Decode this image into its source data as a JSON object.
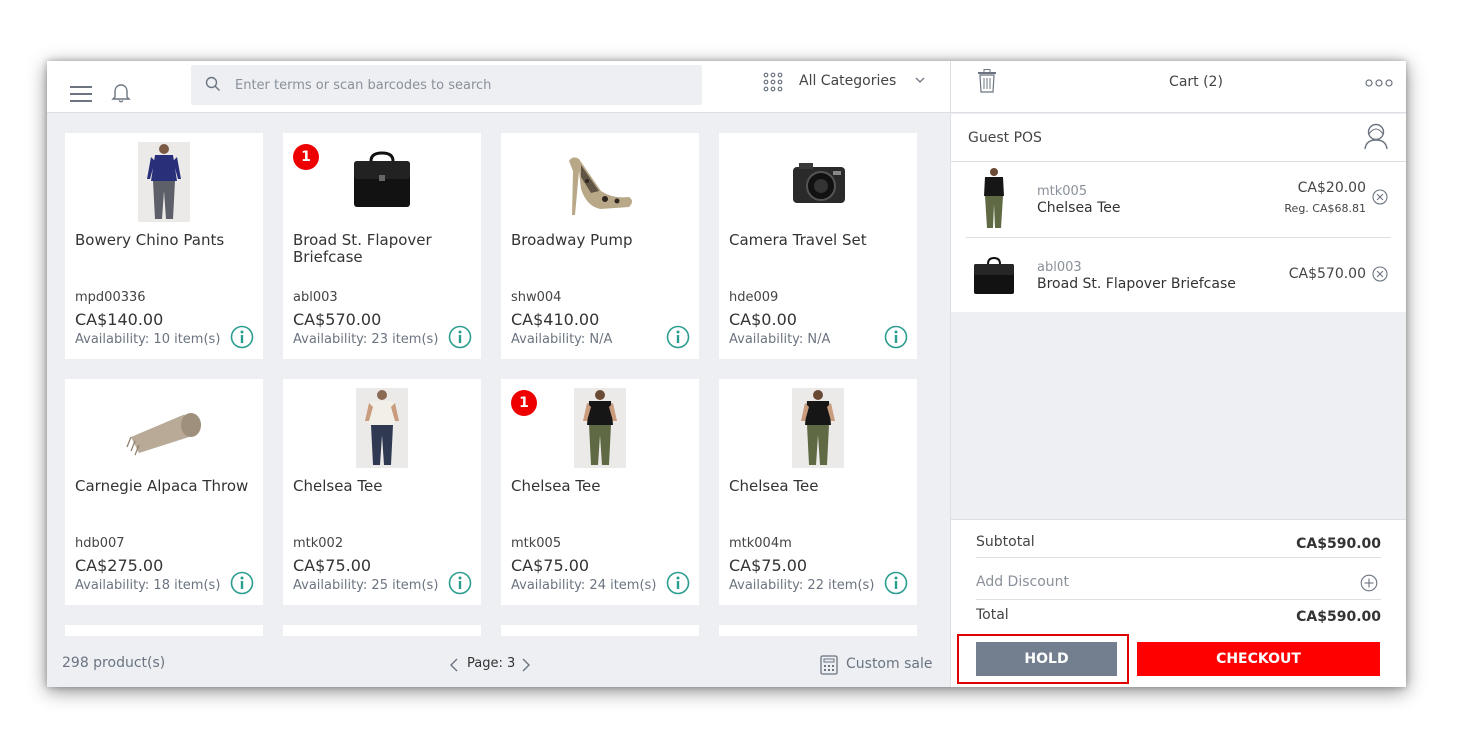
{
  "header": {
    "search_placeholder": "Enter terms or scan barcodes to search",
    "category_label": "All Categories"
  },
  "products": [
    {
      "name": "Bowery Chino Pants",
      "sku": "mpd00336",
      "price": "CA$140.00",
      "availability": "Availability: 10 item(s)",
      "badge": "",
      "image": "pants-model"
    },
    {
      "name": "Broad St. Flapover Briefcase",
      "sku": "abl003",
      "price": "CA$570.00",
      "availability": "Availability: 23 item(s)",
      "badge": "1",
      "image": "briefcase"
    },
    {
      "name": "Broadway Pump",
      "sku": "shw004",
      "price": "CA$410.00",
      "availability": "Availability: N/A",
      "badge": "",
      "image": "pump-shoe"
    },
    {
      "name": "Camera Travel Set",
      "sku": "hde009",
      "price": "CA$0.00",
      "availability": "Availability: N/A",
      "badge": "",
      "image": "camera"
    },
    {
      "name": "Carnegie Alpaca Throw",
      "sku": "hdb007",
      "price": "CA$275.00",
      "availability": "Availability: 18 item(s)",
      "badge": "",
      "image": "throw-blanket"
    },
    {
      "name": "Chelsea Tee",
      "sku": "mtk002",
      "price": "CA$75.00",
      "availability": "Availability: 25 item(s)",
      "badge": "",
      "image": "white-tee-model"
    },
    {
      "name": "Chelsea Tee",
      "sku": "mtk005",
      "price": "CA$75.00",
      "availability": "Availability: 24 item(s)",
      "badge": "1",
      "image": "black-tee-model"
    },
    {
      "name": "Chelsea Tee",
      "sku": "mtk004m",
      "price": "CA$75.00",
      "availability": "Availability: 22 item(s)",
      "badge": "",
      "image": "black-tee-model"
    }
  ],
  "footer": {
    "product_count": "298 product(s)",
    "page_label": "Page: 3",
    "custom_sale_label": "Custom sale"
  },
  "cart": {
    "title": "Cart (2)",
    "customer": "Guest POS",
    "lines": [
      {
        "sku": "mtk005",
        "name": "Chelsea Tee",
        "price": "CA$20.00",
        "regular": "Reg. CA$68.81",
        "image": "black-tee-model"
      },
      {
        "sku": "abl003",
        "name": "Broad St. Flapover Briefcase",
        "price": "CA$570.00",
        "regular": "",
        "image": "briefcase"
      }
    ],
    "subtotal_label": "Subtotal",
    "subtotal_value": "CA$590.00",
    "discount_label": "Add Discount",
    "total_label": "Total",
    "total_value": "CA$590.00",
    "hold_label": "HOLD",
    "checkout_label": "CHECKOUT"
  },
  "colors": {
    "accent_red": "#ff0000",
    "hold_gray": "#737f8e",
    "info_teal": "#2a9d8f",
    "panel_bg": "#edeff3"
  }
}
